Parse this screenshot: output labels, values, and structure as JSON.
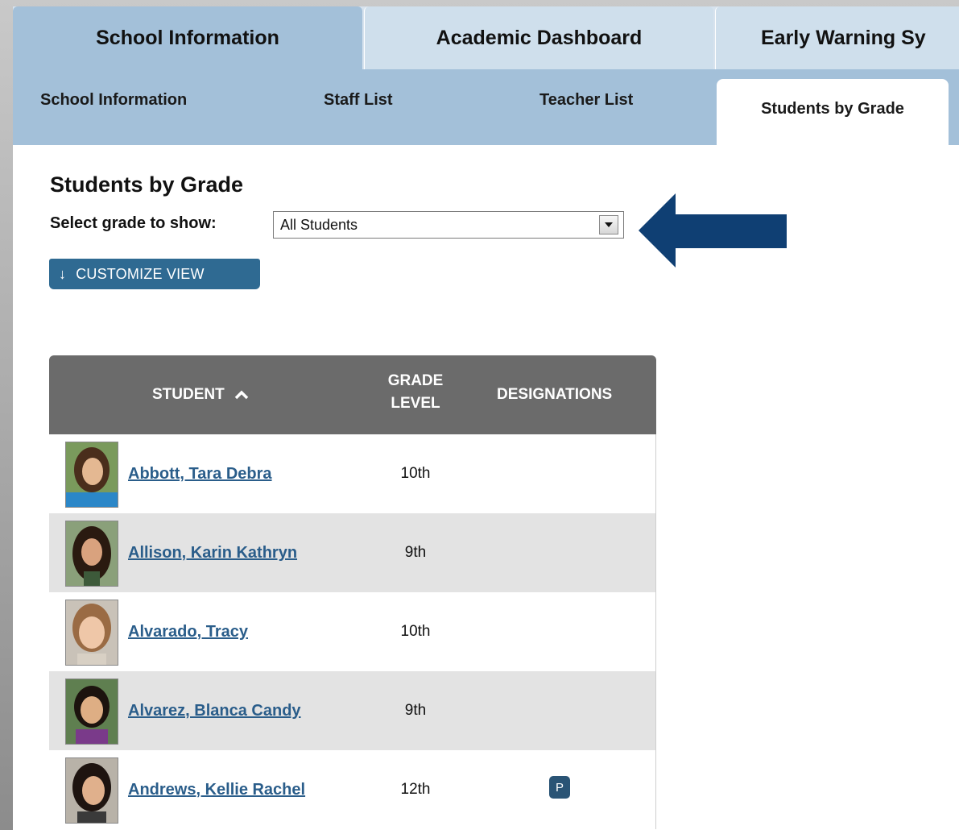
{
  "colors": {
    "tab_active": "#a3c0d9",
    "tab_inactive": "#cfdfec",
    "header_gray": "#6b6b6b",
    "link_blue": "#2a5d8a",
    "button_blue": "#2f6a92",
    "arrow_navy": "#0f3f73",
    "badge_navy": "#2a5475"
  },
  "main_tabs": [
    {
      "label": "School Information",
      "active": true
    },
    {
      "label": "Academic Dashboard",
      "active": false
    },
    {
      "label": "Early Warning Sy",
      "active": false
    }
  ],
  "sub_tabs": [
    {
      "label": "School Information",
      "active": false
    },
    {
      "label": "Staff List",
      "active": false
    },
    {
      "label": "Teacher List",
      "active": false
    },
    {
      "label": "Students by Grade",
      "active": true
    }
  ],
  "page": {
    "title": "Students by Grade",
    "grade_label": "Select grade to show:",
    "grade_selected": "All Students",
    "customize_label": "CUSTOMIZE VIEW",
    "customize_icon": "down-arrow-icon"
  },
  "table": {
    "columns": {
      "student": "STUDENT",
      "grade_line1": "GRADE",
      "grade_line2": "LEVEL",
      "designations": "DESIGNATIONS"
    },
    "sort_icon": "chevron-up-icon",
    "rows": [
      {
        "name": "Abbott, Tara Debra",
        "grade": "10th",
        "designation": ""
      },
      {
        "name": "Allison, Karin Kathryn",
        "grade": "9th",
        "designation": ""
      },
      {
        "name": "Alvarado, Tracy",
        "grade": "10th",
        "designation": ""
      },
      {
        "name": "Alvarez, Blanca Candy",
        "grade": "9th",
        "designation": ""
      },
      {
        "name": "Andrews, Kellie Rachel",
        "grade": "12th",
        "designation": "P"
      }
    ]
  }
}
